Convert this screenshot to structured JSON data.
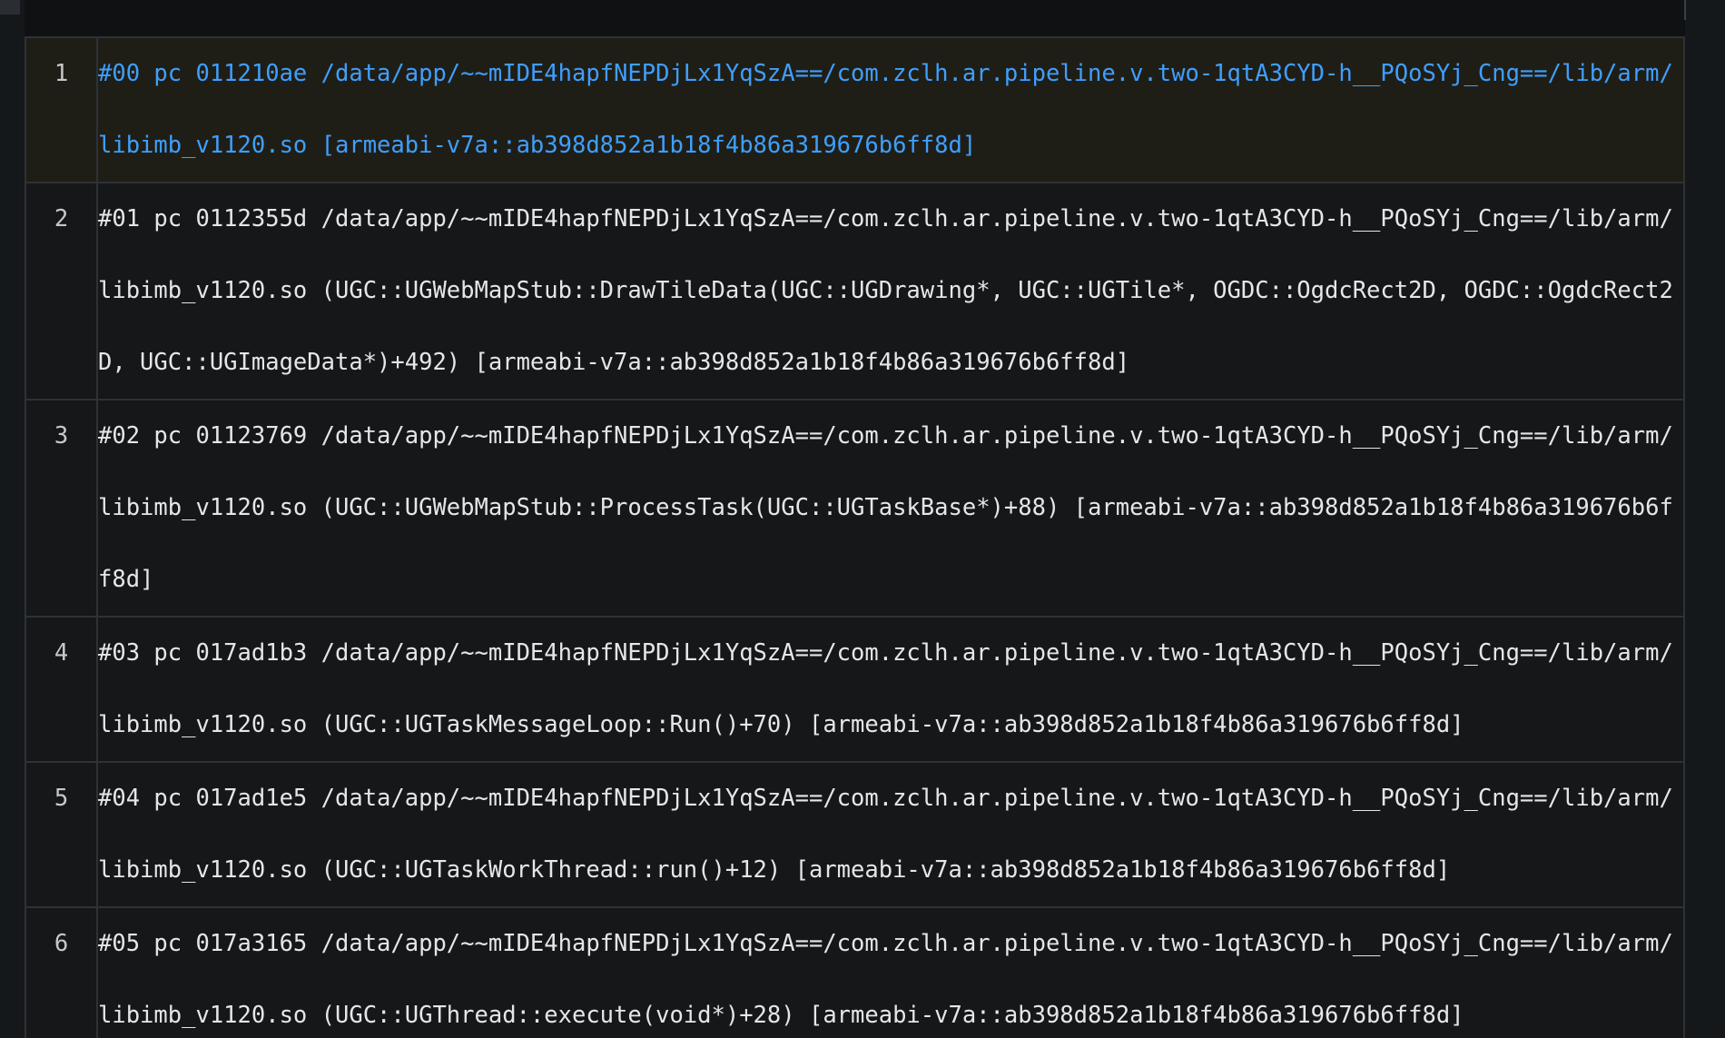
{
  "colors": {
    "background": "#0f1113",
    "row_background": "#151719",
    "highlight_row_background": "#1f1e16",
    "highlight_text": "#3f9fff",
    "text": "#e6e6e6",
    "border": "#2e3236"
  },
  "stack_trace": {
    "rows": [
      {
        "line": "1",
        "text": "#00 pc 011210ae /data/app/~~mIDE4hapfNEPDjLx1YqSzA==/com.zclh.ar.pipeline.v.two-1qtA3CYD-h__PQoSYj_Cng==/lib/arm/libimb_v1120.so [armeabi-v7a::ab398d852a1b18f4b86a319676b6ff8d]",
        "highlighted": true
      },
      {
        "line": "2",
        "text": "#01 pc 0112355d /data/app/~~mIDE4hapfNEPDjLx1YqSzA==/com.zclh.ar.pipeline.v.two-1qtA3CYD-h__PQoSYj_Cng==/lib/arm/libimb_v1120.so (UGC::UGWebMapStub::DrawTileData(UGC::UGDrawing*, UGC::UGTile*, OGDC::OgdcRect2D, OGDC::OgdcRect2D, UGC::UGImageData*)+492) [armeabi-v7a::ab398d852a1b18f4b86a319676b6ff8d]",
        "highlighted": false
      },
      {
        "line": "3",
        "text": "#02 pc 01123769 /data/app/~~mIDE4hapfNEPDjLx1YqSzA==/com.zclh.ar.pipeline.v.two-1qtA3CYD-h__PQoSYj_Cng==/lib/arm/libimb_v1120.so (UGC::UGWebMapStub::ProcessTask(UGC::UGTaskBase*)+88) [armeabi-v7a::ab398d852a1b18f4b86a319676b6ff8d]",
        "highlighted": false
      },
      {
        "line": "4",
        "text": "#03 pc 017ad1b3 /data/app/~~mIDE4hapfNEPDjLx1YqSzA==/com.zclh.ar.pipeline.v.two-1qtA3CYD-h__PQoSYj_Cng==/lib/arm/libimb_v1120.so (UGC::UGTaskMessageLoop::Run()+70) [armeabi-v7a::ab398d852a1b18f4b86a319676b6ff8d]",
        "highlighted": false
      },
      {
        "line": "5",
        "text": "#04 pc 017ad1e5 /data/app/~~mIDE4hapfNEPDjLx1YqSzA==/com.zclh.ar.pipeline.v.two-1qtA3CYD-h__PQoSYj_Cng==/lib/arm/libimb_v1120.so (UGC::UGTaskWorkThread::run()+12) [armeabi-v7a::ab398d852a1b18f4b86a319676b6ff8d]",
        "highlighted": false
      },
      {
        "line": "6",
        "text": "#05 pc 017a3165 /data/app/~~mIDE4hapfNEPDjLx1YqSzA==/com.zclh.ar.pipeline.v.two-1qtA3CYD-h__PQoSYj_Cng==/lib/arm/libimb_v1120.so (UGC::UGThread::execute(void*)+28) [armeabi-v7a::ab398d852a1b18f4b86a319676b6ff8d]",
        "highlighted": false
      }
    ]
  }
}
